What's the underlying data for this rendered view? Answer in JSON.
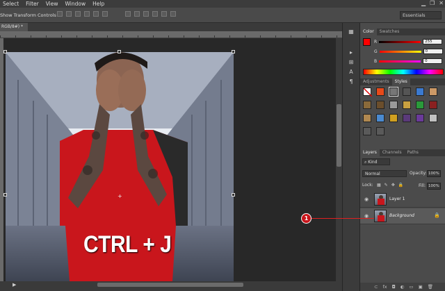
{
  "menu": [
    "Select",
    "Filter",
    "View",
    "Window",
    "Help"
  ],
  "options_bar": {
    "show_transform_label": "Show Transform Controls",
    "workspace": "Essentials"
  },
  "document": {
    "tab_label": "RGB/8#) *"
  },
  "overlay_text": "CTRL + J",
  "color_panel": {
    "tabs": [
      "Color",
      "Swatches"
    ],
    "r_label": "R",
    "r_value": "255",
    "g_label": "G",
    "g_value": "0",
    "b_label": "B",
    "b_value": "0",
    "foreground": "#ff0000"
  },
  "styles_panel": {
    "tabs": [
      "Adjustments",
      "Styles"
    ]
  },
  "layers_panel": {
    "tabs": [
      "Layers",
      "Channels",
      "Paths"
    ],
    "kind_label": "Kind",
    "blend_mode": "Normal",
    "opacity_label": "Opacity:",
    "opacity_value": "100%",
    "lock_label": "Lock:",
    "fill_label": "Fill:",
    "fill_value": "100%",
    "layers": [
      {
        "name": "Layer 1"
      },
      {
        "name": "Background"
      }
    ]
  },
  "callout": {
    "number": "1"
  }
}
